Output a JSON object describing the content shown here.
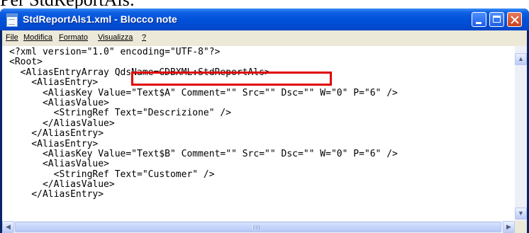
{
  "caption": "Per StdReportAls:",
  "window": {
    "title": "StdReportAls1.xml - Blocco note"
  },
  "menu": {
    "items": [
      "File",
      "Modifica",
      "Formato",
      "Visualizza",
      "?"
    ]
  },
  "editor": {
    "lines": [
      "<?xml version=\"1.0\" encoding=\"UTF-8\"?>",
      "<Root>",
      "  <AliasEntryArray QdsName=GDBXML:StdReportAls>",
      "    <AliasEntry>",
      "      <AliasKey Value=\"Text$A\" Comment=\"\" Src=\"\" Dsc=\"\" W=\"0\" P=\"6\" />",
      "      <AliasValue>",
      "        <StringRef Text=\"Descrizione\" />",
      "      </AliasValue>",
      "    </AliasEntry>",
      "    <AliasEntry>",
      "      <AliasKey Value=\"Text$B\" Comment=\"\" Src=\"\" Dsc=\"\" W=\"0\" P=\"6\" />",
      "      <AliasValue>",
      "        <StringRef Text=\"Customer\" />",
      "      </AliasValue>",
      "    </AliasEntry>"
    ]
  },
  "colors": {
    "titlebar": "#0050d8",
    "highlight_border": "#e00000",
    "menubar": "#ece9d8"
  },
  "icons": [
    "notepad-icon",
    "minimize-icon",
    "maximize-icon",
    "close-icon",
    "scroll-up-icon",
    "scroll-down-icon",
    "scroll-left-icon",
    "scroll-right-icon"
  ]
}
